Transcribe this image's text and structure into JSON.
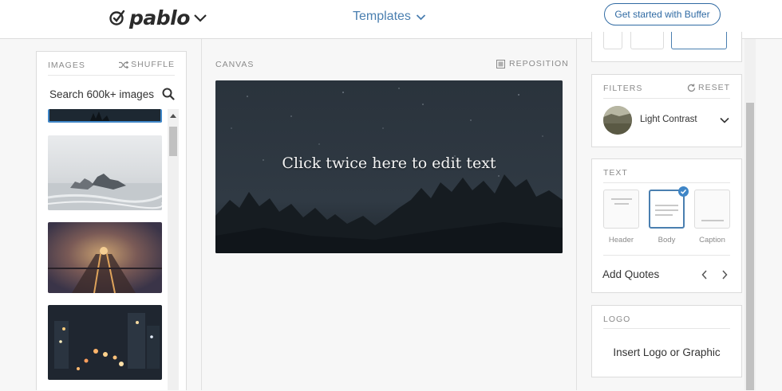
{
  "header": {
    "brand": "pablo",
    "templates_label": "Templates",
    "cta_label": "Get started with Buffer"
  },
  "images": {
    "section_label": "IMAGES",
    "shuffle_label": "SHUFFLE",
    "search_placeholder": "Search 600k+ images"
  },
  "canvas": {
    "section_label": "CANVAS",
    "reposition_label": "REPOSITION",
    "text": "Click twice here to edit text"
  },
  "filters": {
    "section_label": "FILTERS",
    "reset_label": "RESET",
    "selected_filter": "Light Contrast"
  },
  "text_panel": {
    "section_label": "TEXT",
    "options": [
      "Header",
      "Body",
      "Caption"
    ],
    "selected_option": "Body",
    "add_quotes_label": "Add Quotes"
  },
  "logo_panel": {
    "section_label": "LOGO",
    "insert_label": "Insert Logo or Graphic"
  },
  "colors": {
    "accent": "#4a7fb0",
    "cta": "#2f6aa3",
    "canvas_bg": "#27303a"
  }
}
